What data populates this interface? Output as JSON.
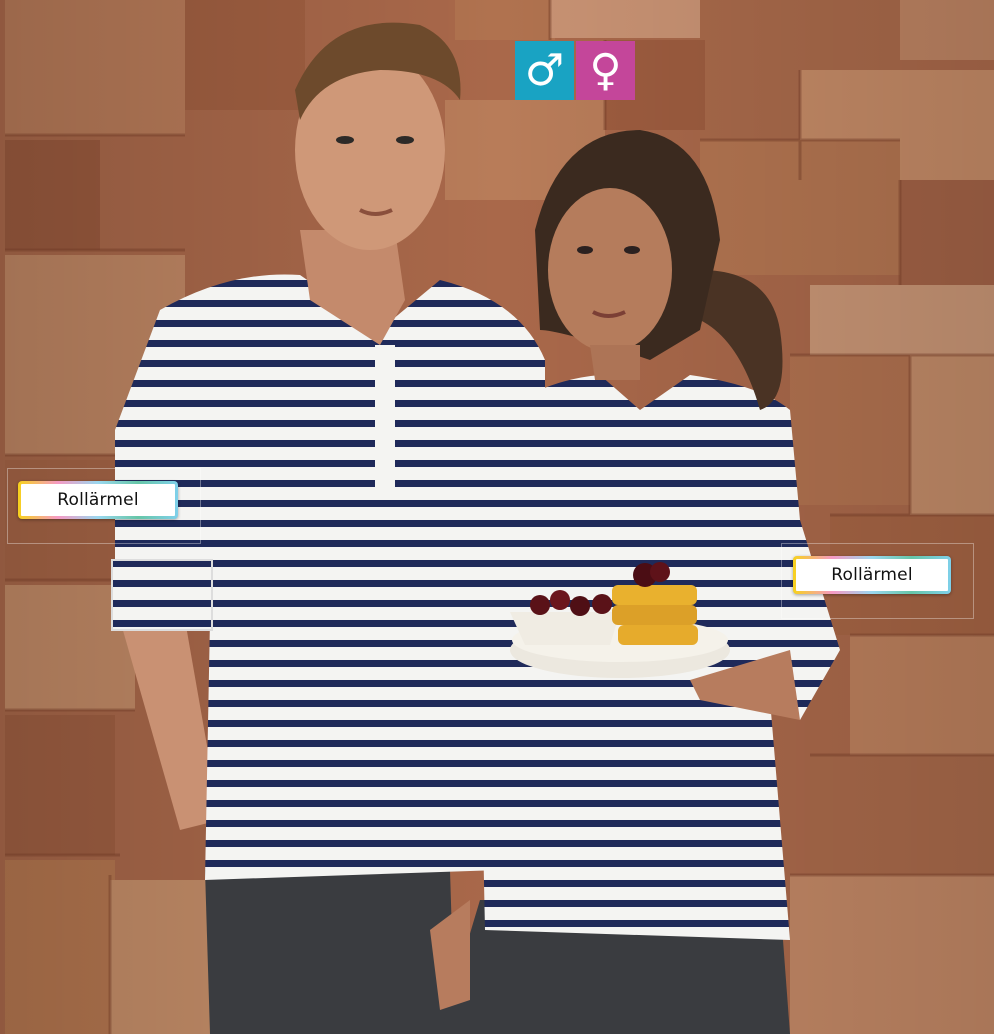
{
  "gender_badges": {
    "male": {
      "symbol": "♂",
      "color": "#19a3c3",
      "icon": "male-symbol-icon"
    },
    "female": {
      "symbol": "♀",
      "color": "#c4469a",
      "icon": "female-symbol-icon"
    }
  },
  "labels": {
    "left_feature": "Rollärmel",
    "right_feature": "Rollärmel"
  },
  "colors": {
    "wood_wall": "#b07050",
    "stripe_navy": "#1f2a5a",
    "shirt_white": "#f4f4f2",
    "trousers": "#3a3c40"
  }
}
